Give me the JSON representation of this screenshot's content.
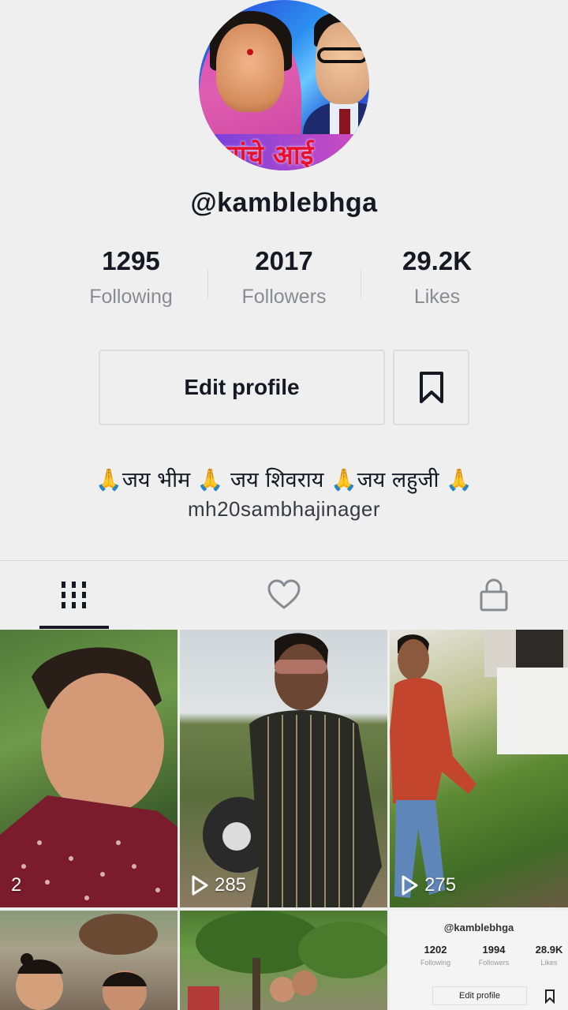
{
  "profile": {
    "username": "@kamblebhga",
    "avatar_banner_text": "चांचे आई"
  },
  "stats": [
    {
      "value": "1295",
      "label": "Following"
    },
    {
      "value": "2017",
      "label": "Followers"
    },
    {
      "value": "29.2K",
      "label": "Likes"
    }
  ],
  "actions": {
    "edit_profile_label": "Edit profile",
    "bookmark_icon": "bookmark-icon"
  },
  "bio": {
    "line1": "🙏जय भीम 🙏 जय शिवराय 🙏जय लहुजी 🙏",
    "line2": "mh20sambhajinager"
  },
  "tabs": [
    {
      "icon": "grid-icon",
      "active": true
    },
    {
      "icon": "heart-icon",
      "active": false
    },
    {
      "icon": "lock-icon",
      "active": false
    }
  ],
  "videos": [
    {
      "views": "2"
    },
    {
      "views": "285"
    },
    {
      "views": "275"
    },
    {
      "views": ""
    },
    {
      "views": ""
    },
    {
      "views": ""
    }
  ],
  "mini_profile": {
    "username": "@kamblebhga",
    "stats": [
      {
        "value": "1202",
        "label": "Following"
      },
      {
        "value": "1994",
        "label": "Followers"
      },
      {
        "value": "28.9K",
        "label": "Likes"
      }
    ],
    "edit_label": "Edit profile"
  },
  "colors": {
    "background": "#efefef",
    "text_primary": "#161823",
    "text_secondary": "#8a8b91",
    "border": "#dcdcdc"
  }
}
